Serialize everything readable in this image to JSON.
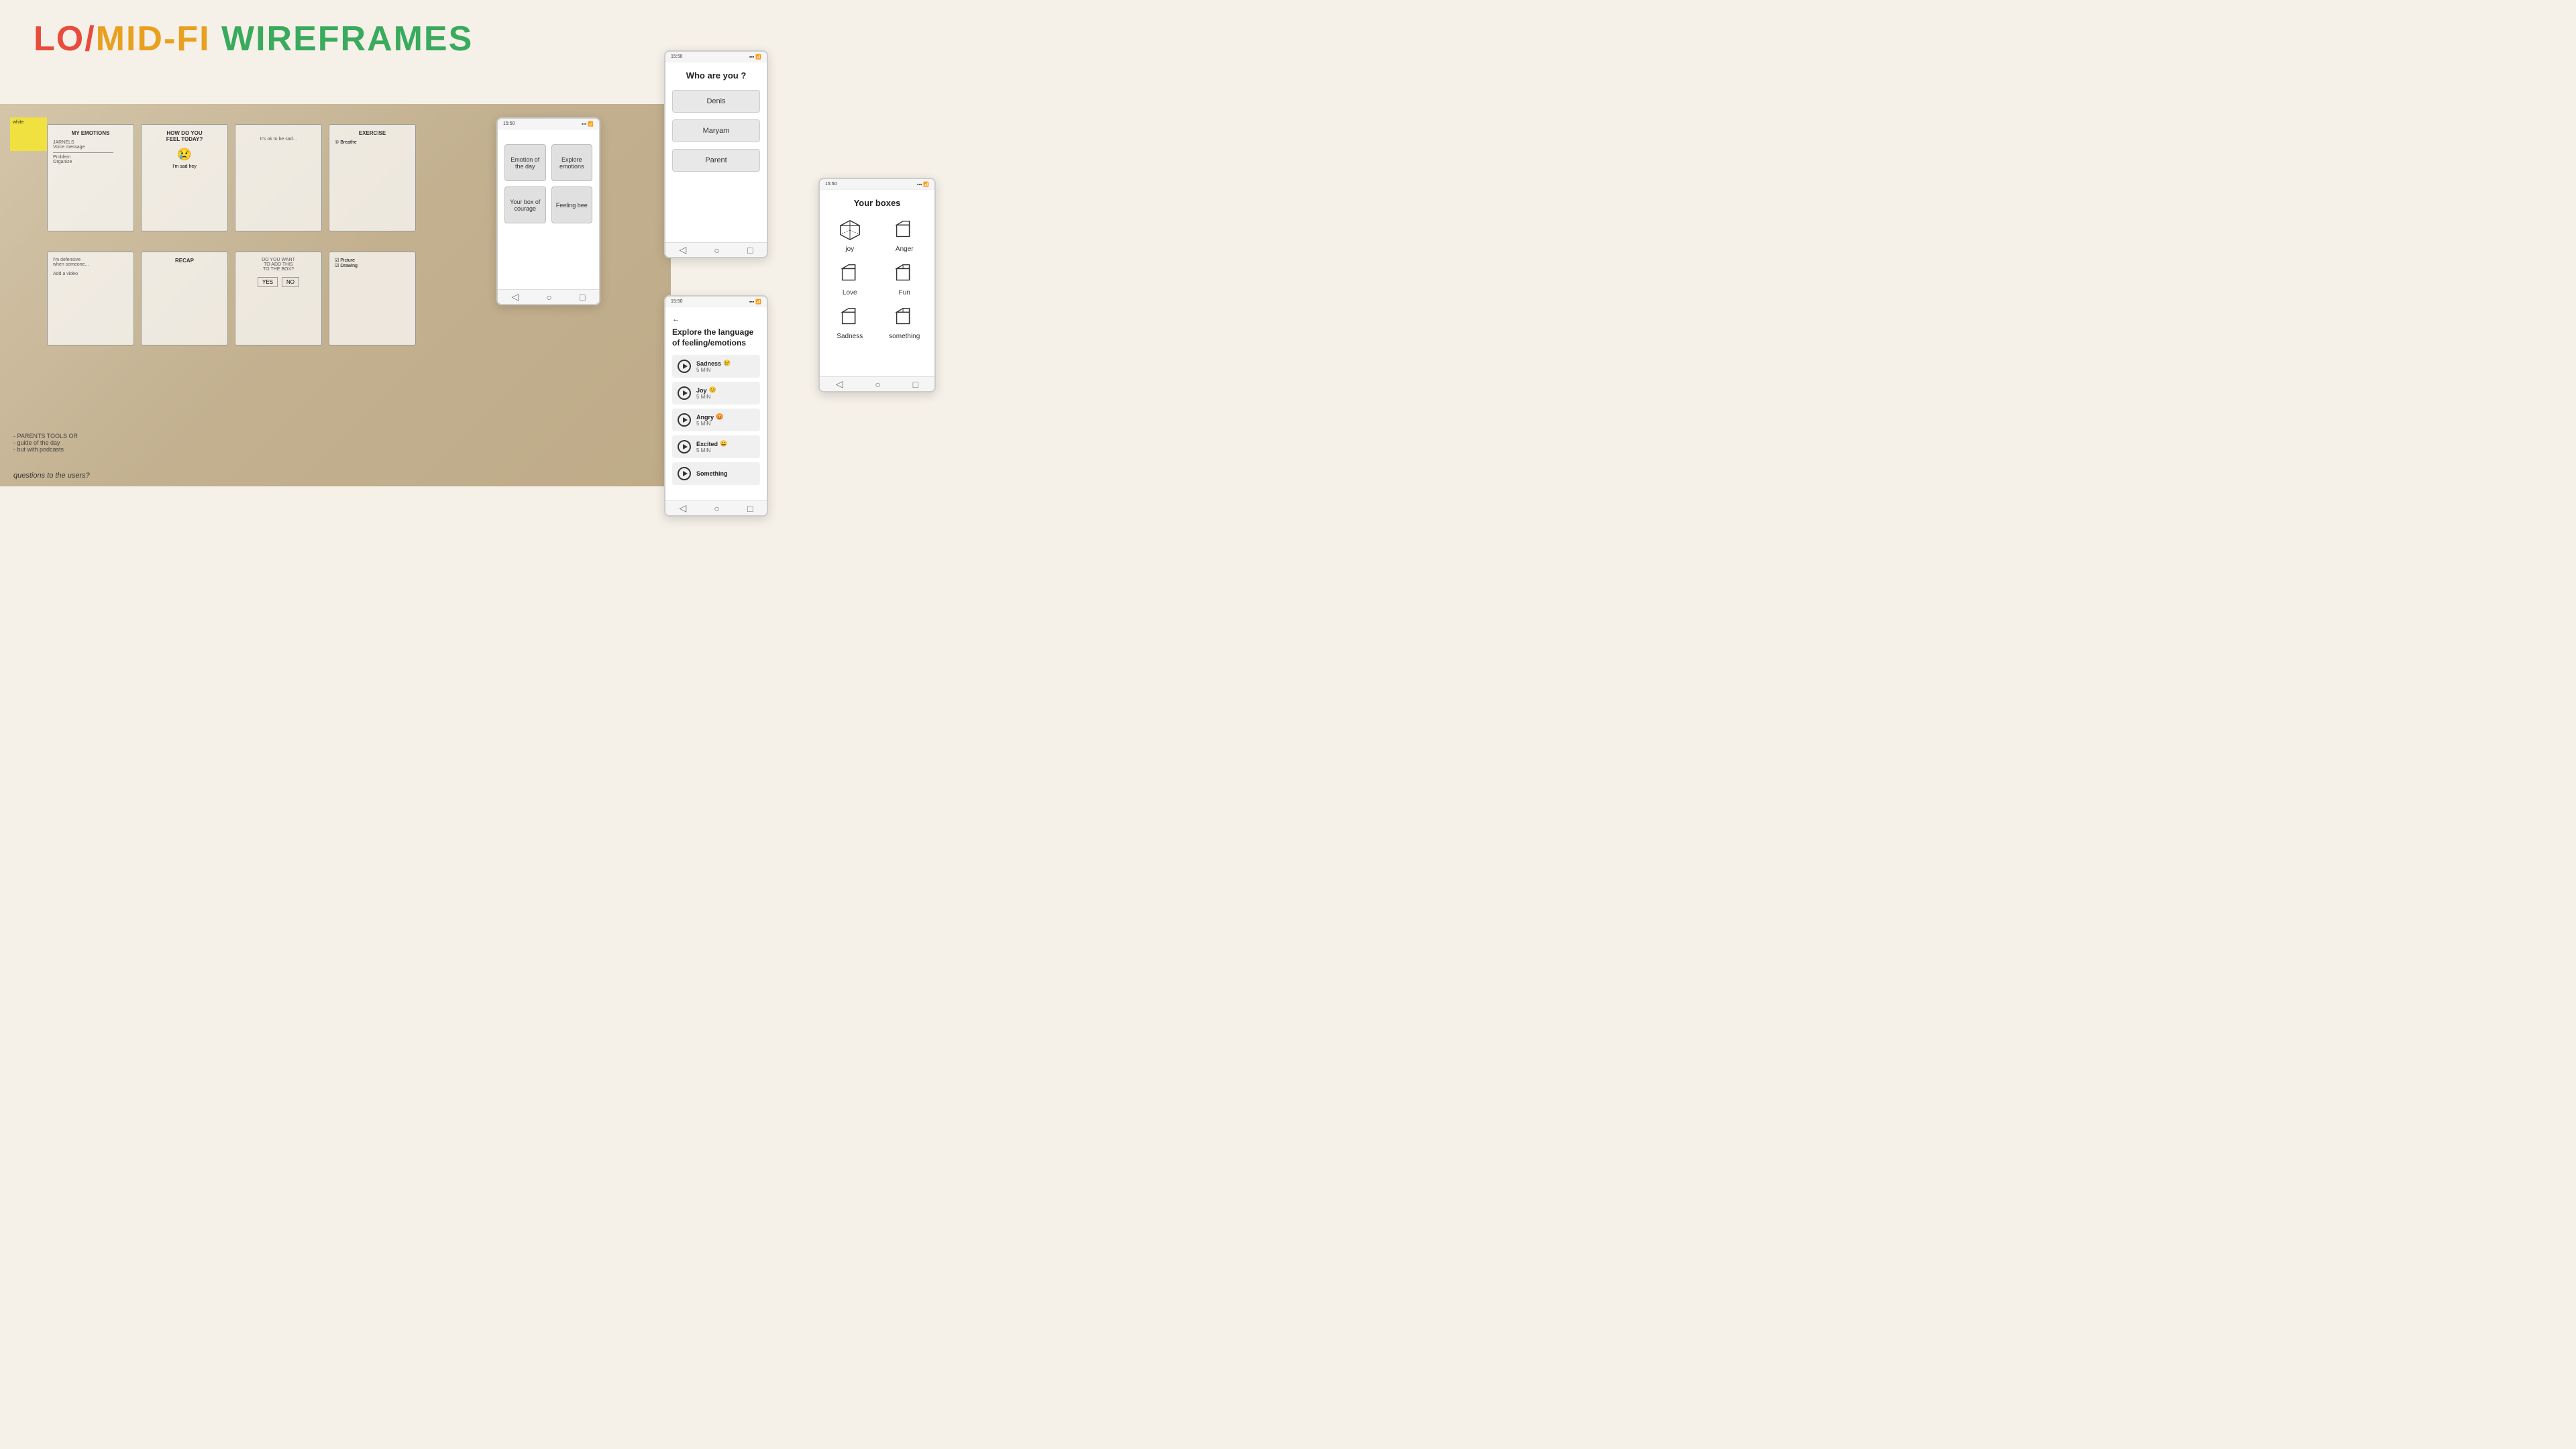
{
  "title": {
    "lo": "LO",
    "slash": "/",
    "mid": "MID",
    "fi": "-FI",
    "space": " ",
    "wire": "WIRE",
    "frames": "FRAMES"
  },
  "phone_who": {
    "status_time": "15:50",
    "title": "Who are you ?",
    "users": [
      "Denis",
      "Maryam",
      "Parent"
    ]
  },
  "phone_main": {
    "status_time": "15:50",
    "menu_items": [
      {
        "label": "Emotion of the day"
      },
      {
        "label": "Explore emotions"
      },
      {
        "label": "Your box of courage"
      },
      {
        "label": "Feeling bee"
      }
    ]
  },
  "phone_explore": {
    "status_time": "15:50",
    "back_arrow": "←",
    "title": "Explore the language of feeling/emotions",
    "emotions": [
      {
        "name": "Sadness",
        "emoji": "😢",
        "duration": "5 MIN"
      },
      {
        "name": "Joy",
        "emoji": "😊",
        "duration": "5 MIN"
      },
      {
        "name": "Angry",
        "emoji": "😡",
        "duration": "5 MIN"
      },
      {
        "name": "Excited",
        "emoji": "😄",
        "duration": "5 MIN"
      },
      {
        "name": "Something",
        "emoji": "",
        "duration": ""
      }
    ]
  },
  "phone_boxes": {
    "status_time": "15:50",
    "title": "Your boxes",
    "boxes": [
      {
        "label": "joy"
      },
      {
        "label": "Anger"
      },
      {
        "label": "Love"
      },
      {
        "label": "Fun"
      },
      {
        "label": "Sadness"
      },
      {
        "label": "something"
      }
    ]
  },
  "photo_notes": {
    "note1": "- PARENTS TOOLS OR",
    "note2": "- guide of the day",
    "note3": "- but with podcasts"
  },
  "sticky": {
    "text": "white"
  }
}
